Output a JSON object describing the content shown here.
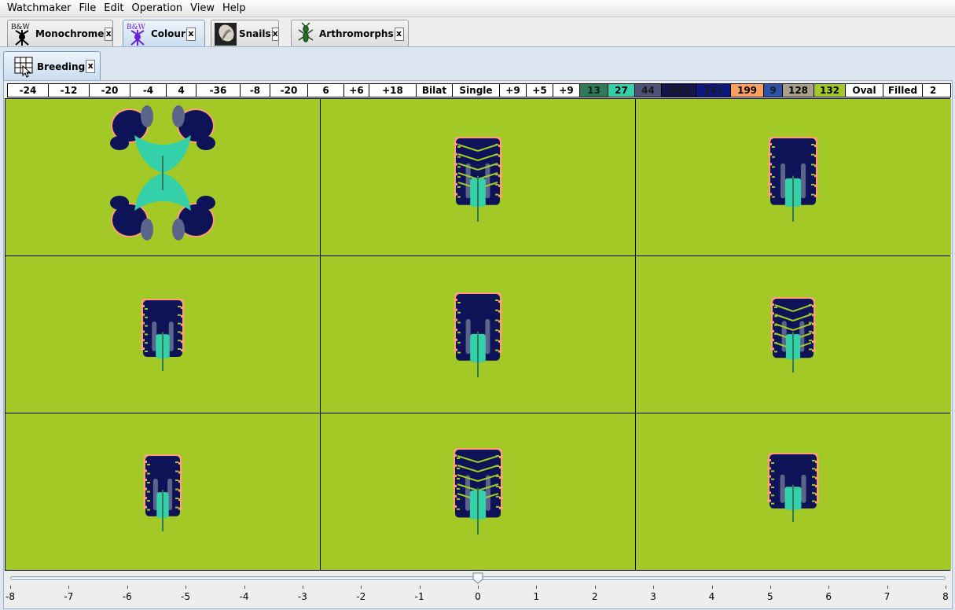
{
  "menubar": {
    "items": [
      "Watchmaker",
      "File",
      "Edit",
      "Operation",
      "View",
      "Help"
    ]
  },
  "app_tabs": [
    {
      "label": "Monochrome",
      "close": "x",
      "icon": "biomorph-bw-icon",
      "active": false
    },
    {
      "label": "Colour",
      "close": "x",
      "icon": "biomorph-colour-icon",
      "active": true
    },
    {
      "label": "Snails",
      "close": "x",
      "icon": "snail-shell-icon",
      "active": false
    },
    {
      "label": "Arthromorphs",
      "close": "x",
      "icon": "arthromorph-icon",
      "active": false
    }
  ],
  "icon_text": {
    "bw": "B&W"
  },
  "sub_tab": {
    "label": "Breeding",
    "close": "x",
    "icon": "breeding-grid-icon"
  },
  "genes": [
    {
      "label": "-24"
    },
    {
      "label": "-12"
    },
    {
      "label": "-20"
    },
    {
      "label": "-4"
    },
    {
      "label": "4"
    },
    {
      "label": "-36"
    },
    {
      "label": "-8"
    },
    {
      "label": "-20"
    },
    {
      "label": "6"
    },
    {
      "label": "+6"
    },
    {
      "label": "+18"
    },
    {
      "label": "Bilat"
    },
    {
      "label": "Single"
    },
    {
      "label": "+9"
    },
    {
      "label": "+5"
    },
    {
      "label": "+9"
    },
    {
      "label": "13",
      "bg": "#2f7a5b"
    },
    {
      "label": "27",
      "bg": "#33d0a9"
    },
    {
      "label": "44",
      "bg": "#4d5278"
    },
    {
      "label": "243",
      "bg": "#15154a"
    },
    {
      "label": "241",
      "bg": "#0c1780"
    },
    {
      "label": "199",
      "bg": "#ff9f5f"
    },
    {
      "label": "9",
      "bg": "#2d52ad"
    },
    {
      "label": "128",
      "bg": "#a8a08a"
    },
    {
      "label": "132",
      "bg": "#a2c926"
    },
    {
      "label": "Oval"
    },
    {
      "label": "Filled"
    },
    {
      "label": "2"
    }
  ],
  "colors": {
    "background": "#a2c926",
    "body": "#33d0a9",
    "dark": "#0e1358",
    "grey": "#5b6489",
    "accent": "#ff9f77",
    "stem": "#2f7a5b"
  },
  "slider": {
    "min": -8,
    "max": 8,
    "value": 0,
    "tick_labels": [
      "-8",
      "-7",
      "-6",
      "-5",
      "-4",
      "-3",
      "-2",
      "-1",
      "0",
      "1",
      "2",
      "3",
      "4",
      "5",
      "6",
      "7",
      "8"
    ]
  }
}
